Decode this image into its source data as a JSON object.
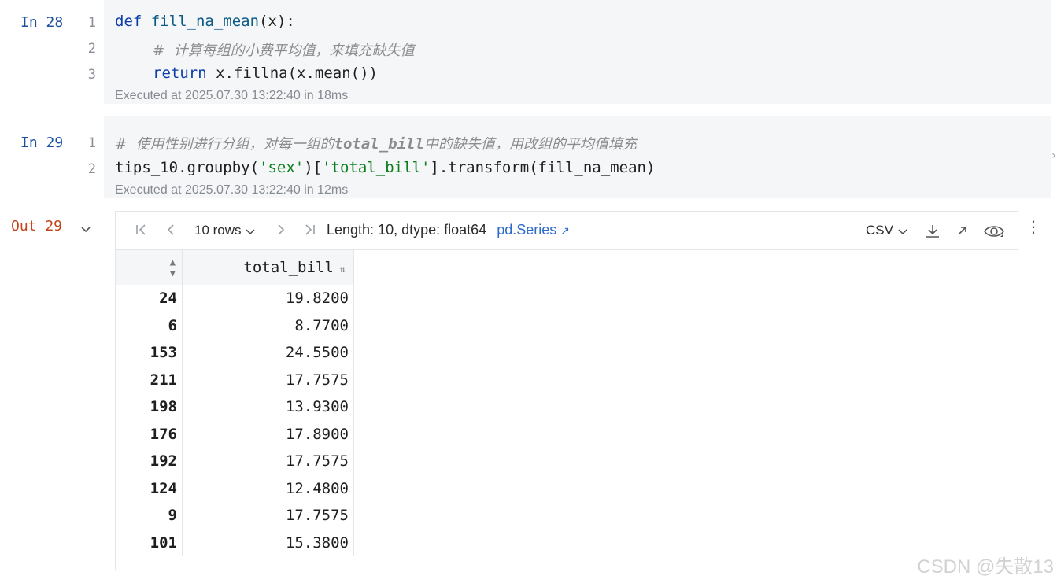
{
  "cell28": {
    "prompt": "In 28",
    "lines": [
      "1",
      "2",
      "3"
    ],
    "code": {
      "kw_def": "def",
      "fn_name": "fill_na_mean",
      "sig_rest": "(x):",
      "comment": "#  计算每组的小费平均值，来填充缺失值",
      "kw_return": "return",
      "return_expr": " x.fillna(x.mean())"
    },
    "executed": "Executed at 2025.07.30 13:22:40 in 18ms"
  },
  "cell29": {
    "prompt": "In 29",
    "lines": [
      "1",
      "2"
    ],
    "code": {
      "comment_a": "#  使用性别进行分组，对每一组的",
      "comment_b": "total_bill",
      "comment_c": "中的缺失值，用改组的平均值填充",
      "l2_a": "tips_10.groupby(",
      "l2_str1": "'sex'",
      "l2_b": ")[",
      "l2_str2": "'total_bill'",
      "l2_c": "].transform(fill_na_mean)"
    },
    "executed": "Executed at 2025.07.30 13:22:40 in 12ms"
  },
  "output": {
    "prompt": "Out 29",
    "toggle_icon": "chevron-down-icon",
    "toolbar": {
      "rows_label": "10 rows",
      "length_label": "Length: 10, dtype: float64",
      "type_link": "pd.Series",
      "csv_label": "CSV"
    },
    "table": {
      "header": "total_bill",
      "rows": [
        {
          "index": "24",
          "value": "19.8200"
        },
        {
          "index": "6",
          "value": "8.7700"
        },
        {
          "index": "153",
          "value": "24.5500"
        },
        {
          "index": "211",
          "value": "17.7575"
        },
        {
          "index": "198",
          "value": "13.9300"
        },
        {
          "index": "176",
          "value": "17.8900"
        },
        {
          "index": "192",
          "value": "17.7575"
        },
        {
          "index": "124",
          "value": "12.4800"
        },
        {
          "index": "9",
          "value": "17.7575"
        },
        {
          "index": "101",
          "value": "15.3800"
        }
      ]
    }
  },
  "watermark": "CSDN @失散13"
}
